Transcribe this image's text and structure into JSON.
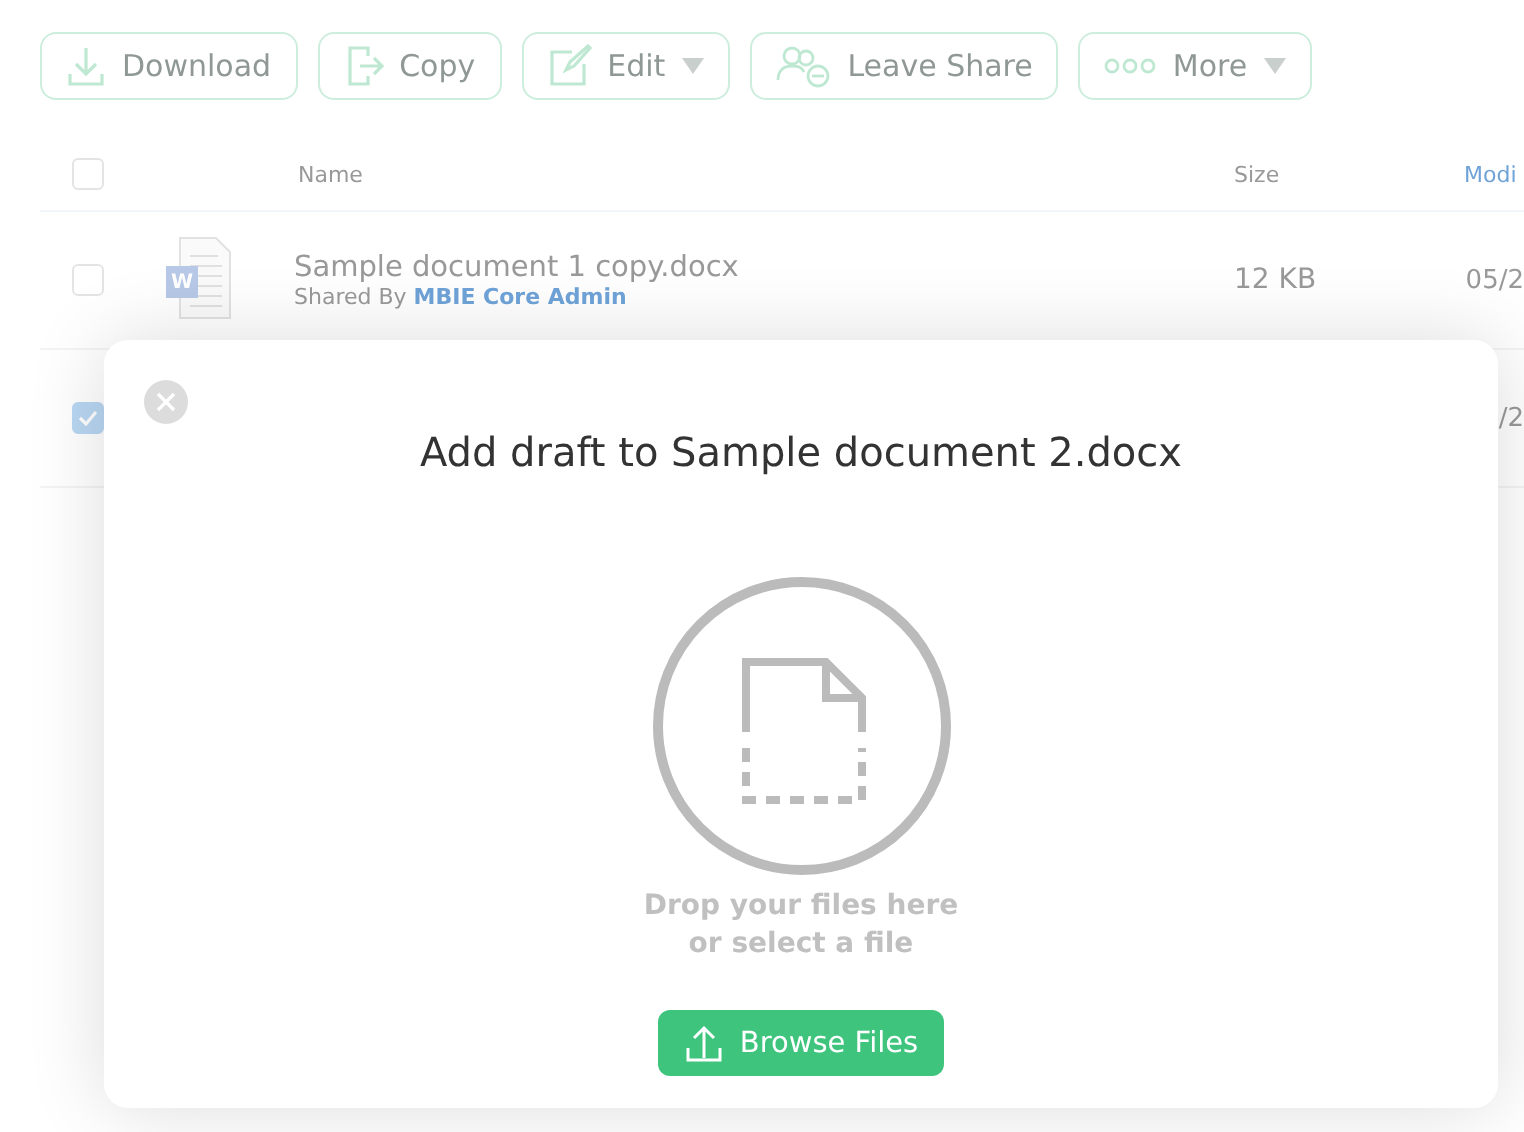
{
  "toolbar": {
    "buttons": [
      {
        "label": "Download",
        "dropdown": false
      },
      {
        "label": "Copy",
        "dropdown": false
      },
      {
        "label": "Edit",
        "dropdown": true
      },
      {
        "label": "Leave Share",
        "dropdown": false
      },
      {
        "label": "More",
        "dropdown": true
      }
    ]
  },
  "table": {
    "select_all_checked": false,
    "columns": [
      "Name",
      "Size",
      "Modi"
    ],
    "rows": [
      {
        "checked": false,
        "icon_letter": "W",
        "name": "Sample document 1 copy.docx",
        "shared_by_label": "Shared By",
        "shared_by": "MBIE Core Admin",
        "size": "12 KB",
        "modified": "05/2"
      },
      {
        "checked": true,
        "modified": "/2"
      }
    ]
  },
  "dialog": {
    "title": "Add draft to Sample document 2.docx",
    "drop_text": "Drop your files here",
    "select_text": "or select a file",
    "button": "Browse Files"
  }
}
